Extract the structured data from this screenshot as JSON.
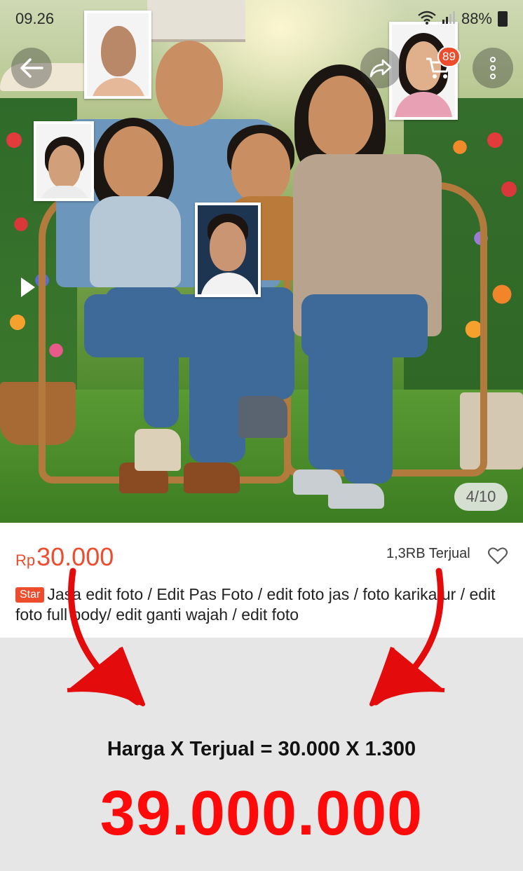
{
  "status_bar": {
    "time": "09.26",
    "battery": "88%"
  },
  "header": {
    "cart_badge": "89"
  },
  "gallery": {
    "counter": "4/10"
  },
  "product": {
    "currency": "Rp",
    "price": "30.000",
    "sold": "1,3RB Terjual",
    "badge": "Star",
    "title": "Jasa edit foto / Edit Pas Foto / edit foto jas / foto karikatur / edit foto full body/ edit ganti wajah / edit foto"
  },
  "calculation": {
    "formula": "Harga X Terjual = 30.000 X 1.300",
    "result": "39.000.000"
  },
  "colors": {
    "accent": "#ee4d2d",
    "result": "#ff0a0a",
    "arrow": "#e30b0b"
  },
  "icons": [
    "back-arrow-icon",
    "share-icon",
    "cart-icon",
    "more-vertical-icon",
    "play-icon",
    "heart-icon",
    "wifi-icon",
    "signal-icon",
    "battery-icon"
  ]
}
